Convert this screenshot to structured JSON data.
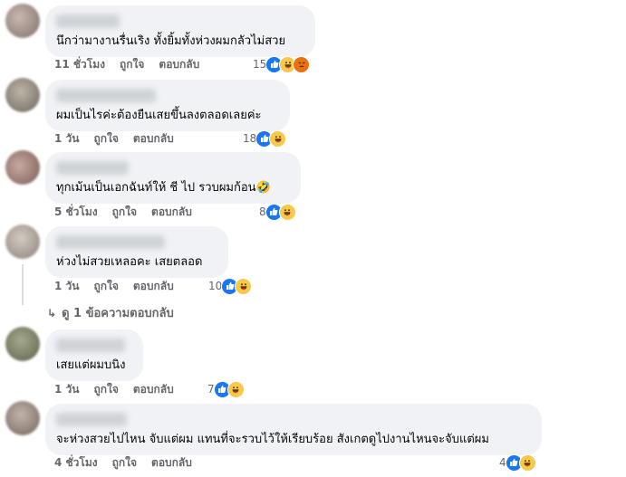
{
  "comments": [
    {
      "text": "นึกว่ามางานรื่นเริง ทั้งยิ้มทั้งห่วงผมกลัวไม่สวย",
      "time": "11 ชั่วโมง",
      "like_label": "ถูกใจ",
      "reply_label": "ตอบกลับ",
      "reaction_count": "15",
      "reactions": [
        "like-icon",
        "haha-icon",
        "angry-icon"
      ]
    },
    {
      "text": "ผมเป็นไรค่ะต้องยืนเสยขึ้นลงตลอดเลยค่ะ",
      "time": "1 วัน",
      "like_label": "ถูกใจ",
      "reply_label": "ตอบกลับ",
      "reaction_count": "18",
      "reactions": [
        "like-icon",
        "haha-icon"
      ]
    },
    {
      "text": "ทุกเม้นเป็นเอกฉันท์ให้ ชี ไป รวบผมก้อน🤣",
      "time": "5 ชั่วโมง",
      "like_label": "ถูกใจ",
      "reply_label": "ตอบกลับ",
      "reaction_count": "8",
      "reactions": [
        "like-icon",
        "haha-icon"
      ]
    },
    {
      "text": "ห่วงไม่สวยเหลอคะ เสยตลอด",
      "time": "1 วัน",
      "like_label": "ถูกใจ",
      "reply_label": "ตอบกลับ",
      "reaction_count": "10",
      "reactions": [
        "like-icon",
        "haha-icon"
      ]
    },
    {
      "text": "เสยแต่ผมบนิง",
      "time": "1 วัน",
      "like_label": "ถูกใจ",
      "reply_label": "ตอบกลับ",
      "reaction_count": "7",
      "reactions": [
        "like-icon",
        "haha-icon"
      ]
    },
    {
      "text": "จะห่วงสวยไปไหน จับแต่ผม แทนที่จะรวบไว้ให้เรียบร้อย สังเกตดูไปงานไหนจะจับแต่ผม",
      "time": "4 ชั่วโมง",
      "like_label": "ถูกใจ",
      "reply_label": "ตอบกลับ",
      "reaction_count": "4",
      "reactions": [
        "like-icon",
        "haha-icon"
      ]
    }
  ],
  "view_replies_label": "ดู 1 ข้อความตอบกลับ",
  "colors": {
    "bubble": "#f0f2f5",
    "meta_text": "#65676b",
    "like": "#1877f2",
    "haha": "#f7c84a",
    "angry": "#e9710f"
  }
}
